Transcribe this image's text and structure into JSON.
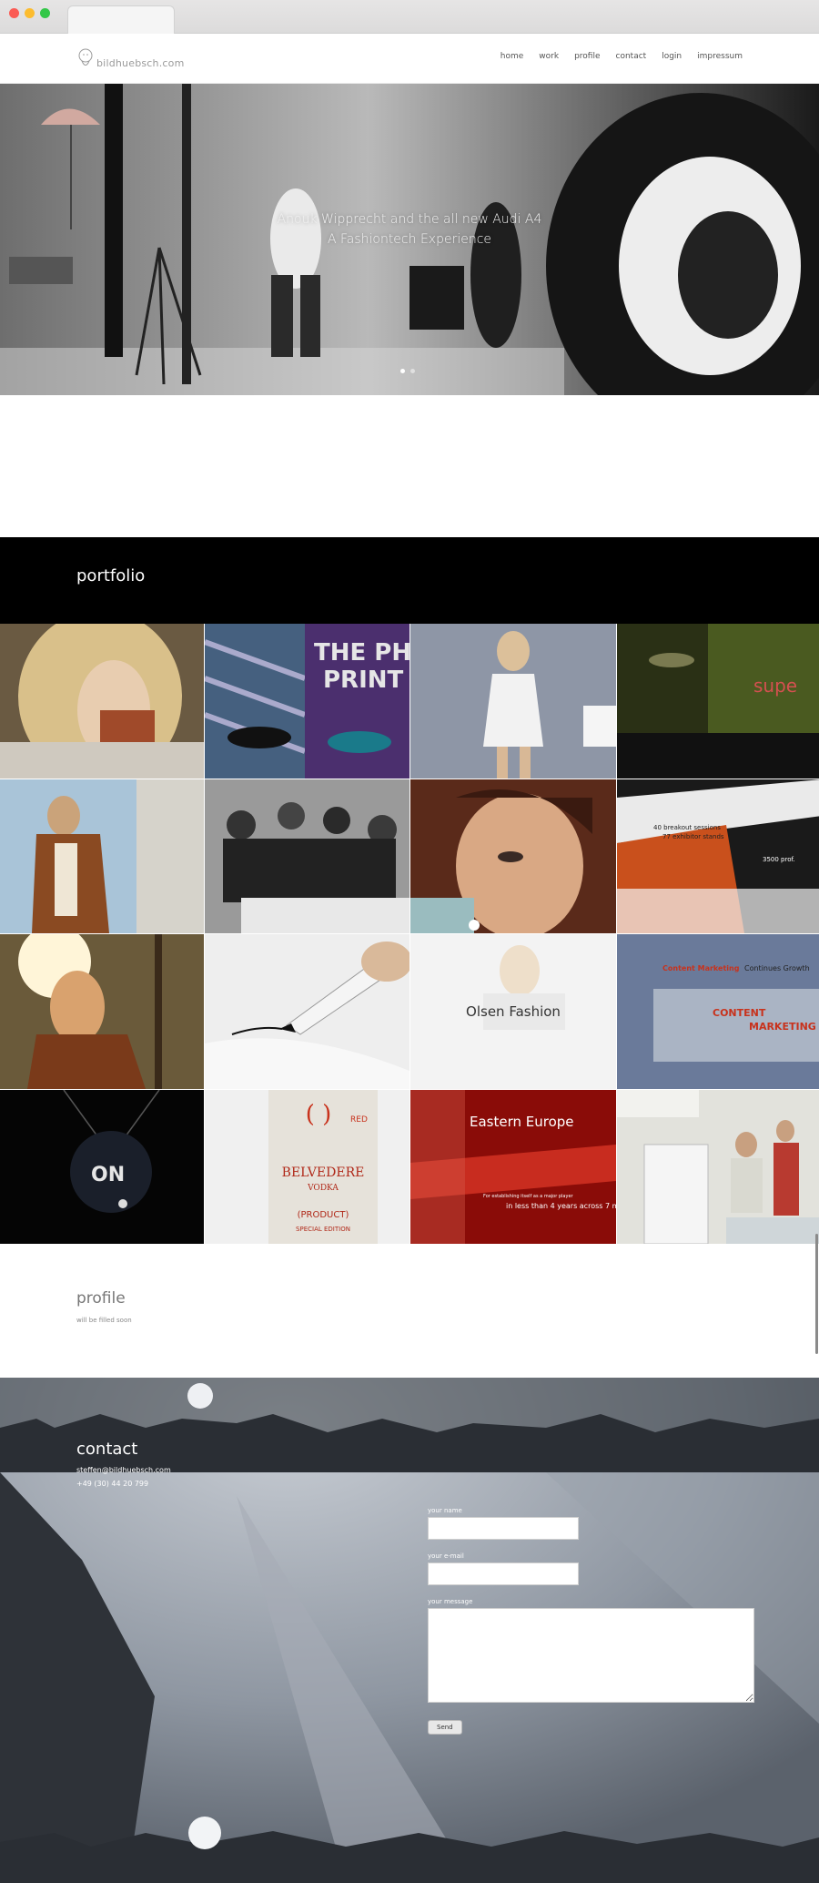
{
  "browser": {
    "tab_title": ""
  },
  "header": {
    "logo_text": "bildhuebsch.com",
    "nav": [
      "home",
      "work",
      "profile",
      "contact",
      "login",
      "impressum"
    ]
  },
  "hero": {
    "caption_line1": "Anouk Wipprecht and the all new Audi A4",
    "caption_line2": "A Fashiontech Experience",
    "slides": 2,
    "active_slide": 1
  },
  "portfolio": {
    "title": "portfolio",
    "tiles": [
      {
        "name": "blonde-woman-gloves"
      },
      {
        "name": "sneakers-print"
      },
      {
        "name": "model-white-dress"
      },
      {
        "name": "event-hall-super"
      },
      {
        "name": "woman-leather-jacket"
      },
      {
        "name": "crowd-bw"
      },
      {
        "name": "woman-closeup"
      },
      {
        "name": "breakout-sessions",
        "text1": "40 breakout sessions",
        "text2": "77 exhibitor stands",
        "text3": "3500 prof."
      },
      {
        "name": "woman-sunlight"
      },
      {
        "name": "pen-writing"
      },
      {
        "name": "olsen-fashion",
        "overlay": "Olsen Fashion"
      },
      {
        "name": "content-marketing",
        "text1": "Content Marketing",
        "text2": "Continues Growth",
        "text3": "CONTENT",
        "text4": "MARKETING"
      },
      {
        "name": "ball-dark",
        "text1": "ON"
      },
      {
        "name": "belvedere-vodka",
        "text1": "BELVEDERE",
        "text2": "VODKA",
        "text3": "(PRODUCT)",
        "text4": "SPECIAL EDITION",
        "text5": "RED"
      },
      {
        "name": "eastern-europe",
        "text1": "Eastern Europe",
        "text2": "For establishing itself as a major player",
        "text3": "in less than 4 years across 7 m"
      },
      {
        "name": "kitchen-couple"
      }
    ]
  },
  "profile": {
    "title": "profile",
    "text": "will be filled soon"
  },
  "contact": {
    "title": "contact",
    "email": "steffen@bildhuebsch.com",
    "phone": "+49 (30) 44 20 799",
    "name_label": "your name",
    "email_label": "your e-mail",
    "message_label": "your message",
    "send_label": "Send"
  }
}
